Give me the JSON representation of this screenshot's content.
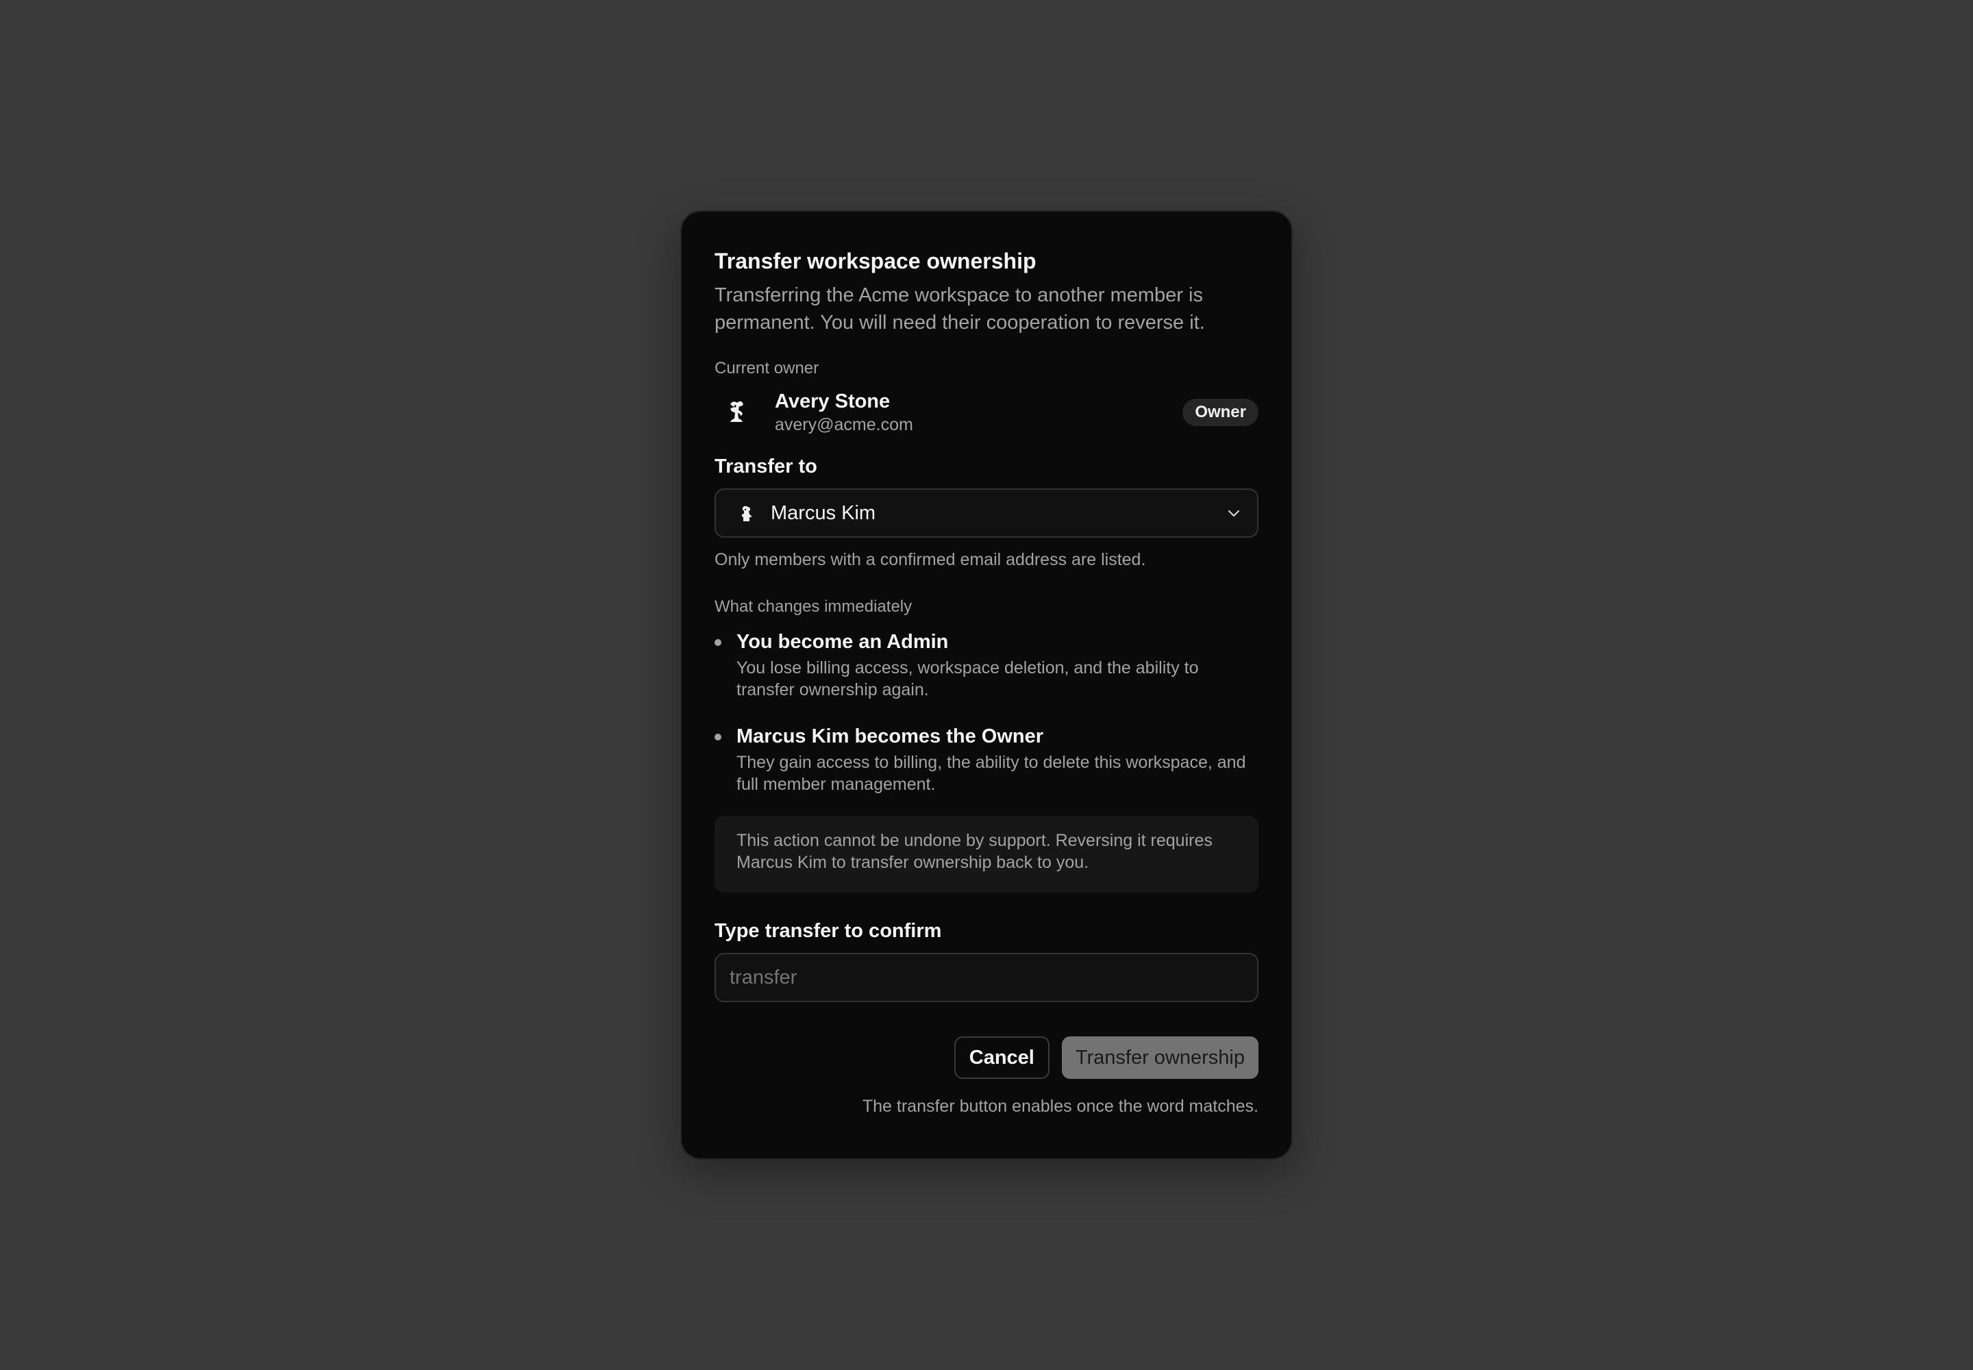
{
  "dialog": {
    "title": "Transfer workspace ownership",
    "description": "Transferring the Acme workspace to another member is permanent. You will need their cooperation to reverse it."
  },
  "current_owner": {
    "label": "Current owner",
    "name": "Avery Stone",
    "email": "avery@acme.com",
    "badge": "Owner"
  },
  "transfer_to": {
    "label": "Transfer to",
    "selected": "Marcus Kim",
    "hint": "Only members with a confirmed email address are listed."
  },
  "changes": {
    "label": "What changes immediately",
    "items": [
      {
        "title": "You become an Admin",
        "description": "You lose billing access, workspace deletion, and the ability to transfer ownership again."
      },
      {
        "title": "Marcus Kim becomes the Owner",
        "description": "They gain access to billing, the ability to delete this workspace, and full member management."
      }
    ]
  },
  "note": "This action cannot be undone by support. Reversing it requires Marcus Kim to transfer ownership back to you.",
  "confirm": {
    "label": "Type transfer to confirm",
    "placeholder": "transfer"
  },
  "actions": {
    "cancel": "Cancel",
    "primary": "Transfer ownership",
    "hint": "The transfer button enables once the word matches."
  },
  "colors": {
    "background": "#3a3a3a",
    "dialog": "#0a0a0a",
    "primary_disabled": "#737373"
  }
}
